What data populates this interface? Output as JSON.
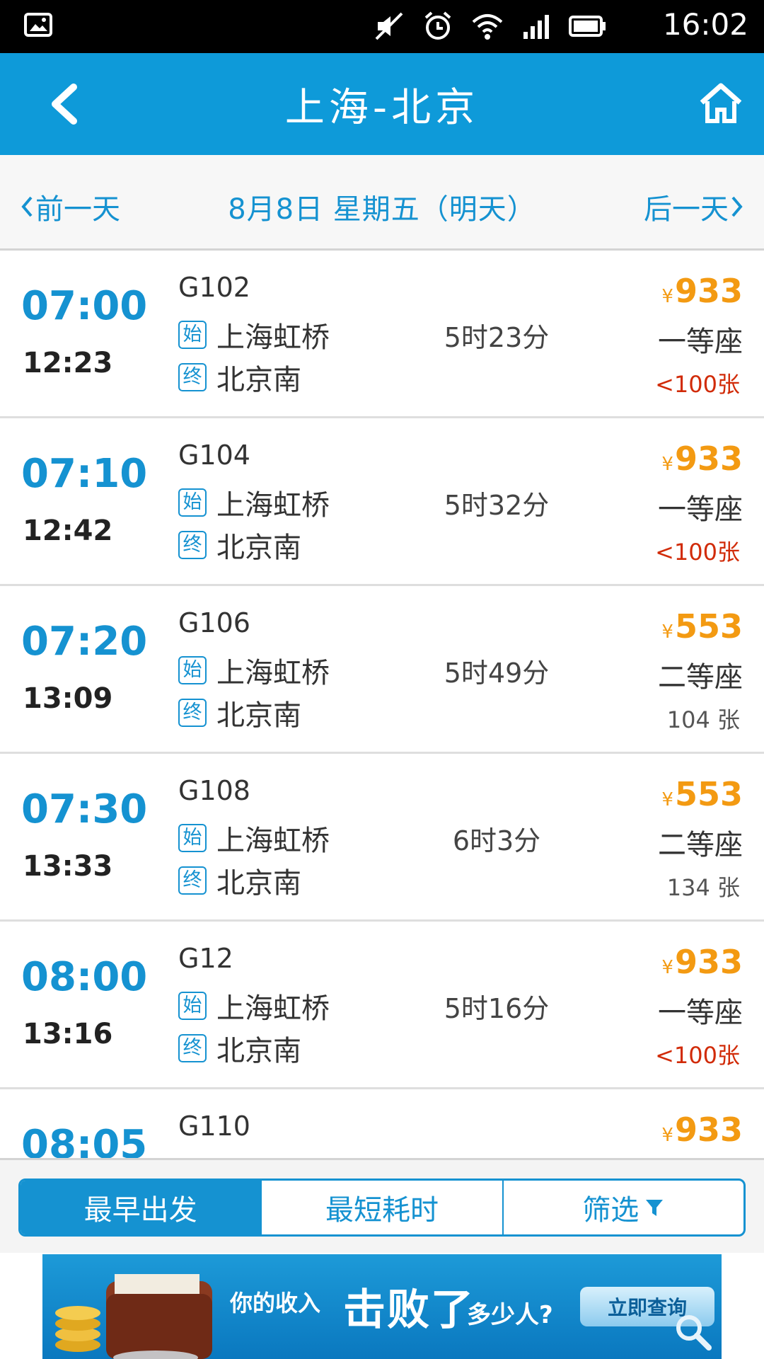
{
  "status_bar": {
    "time": "16:02",
    "icons": [
      "gallery-icon",
      "mute-icon",
      "alarm-icon",
      "wifi-icon",
      "signal-icon",
      "battery-icon"
    ]
  },
  "header": {
    "title": "上海-北京",
    "back_icon": "chevron-left-icon",
    "home_icon": "home-icon",
    "color": "#0e9ad9"
  },
  "date_nav": {
    "prev_label": "前一天",
    "current": "8月8日 星期五（明天）",
    "next_label": "后一天"
  },
  "trains": [
    {
      "depart": "07:00",
      "arrive": "12:23",
      "train_no": "G102",
      "from_badge": "始",
      "from": "上海虹桥",
      "to_badge": "终",
      "to": "北京南",
      "duration": "5时23分",
      "currency": "¥",
      "price": "933",
      "seat": "一等座",
      "tickets": "<100张",
      "low": true
    },
    {
      "depart": "07:10",
      "arrive": "12:42",
      "train_no": "G104",
      "from_badge": "始",
      "from": "上海虹桥",
      "to_badge": "终",
      "to": "北京南",
      "duration": "5时32分",
      "currency": "¥",
      "price": "933",
      "seat": "一等座",
      "tickets": "<100张",
      "low": true
    },
    {
      "depart": "07:20",
      "arrive": "13:09",
      "train_no": "G106",
      "from_badge": "始",
      "from": "上海虹桥",
      "to_badge": "终",
      "to": "北京南",
      "duration": "5时49分",
      "currency": "¥",
      "price": "553",
      "seat": "二等座",
      "tickets": "104 张",
      "low": false
    },
    {
      "depart": "07:30",
      "arrive": "13:33",
      "train_no": "G108",
      "from_badge": "始",
      "from": "上海虹桥",
      "to_badge": "终",
      "to": "北京南",
      "duration": "6时3分",
      "currency": "¥",
      "price": "553",
      "seat": "二等座",
      "tickets": "134 张",
      "low": false
    },
    {
      "depart": "08:00",
      "arrive": "13:16",
      "train_no": "G12",
      "from_badge": "始",
      "from": "上海虹桥",
      "to_badge": "终",
      "to": "北京南",
      "duration": "5时16分",
      "currency": "¥",
      "price": "933",
      "seat": "一等座",
      "tickets": "<100张",
      "low": true
    },
    {
      "depart": "08:05",
      "arrive": "",
      "train_no": "G110",
      "from_badge": "",
      "from": "",
      "to_badge": "",
      "to": "",
      "duration": "",
      "currency": "¥",
      "price": "933",
      "seat": "",
      "tickets": "",
      "low": false
    }
  ],
  "sort_bar": {
    "earliest": "最早出发",
    "shortest": "最短耗时",
    "filter": "筛选",
    "active": "earliest"
  },
  "ad": {
    "text1": "你的收入",
    "text2": "击败了",
    "text3": "多少人?",
    "cta": "立即查询"
  },
  "colors": {
    "accent": "#1592d1",
    "price": "#f39a12",
    "low_tickets": "#d12b08"
  }
}
